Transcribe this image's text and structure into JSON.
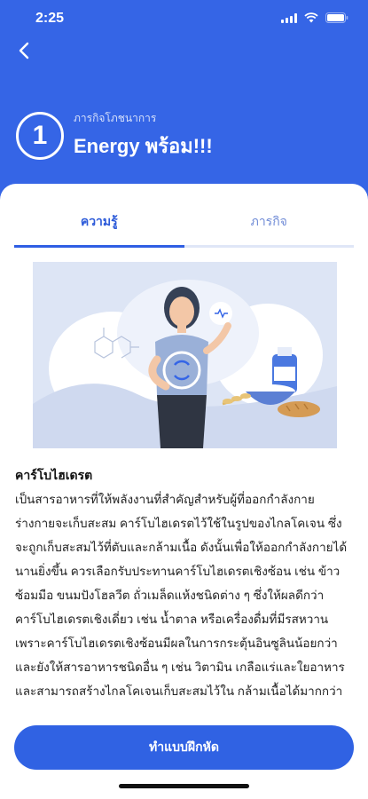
{
  "status_bar": {
    "time": "2:25"
  },
  "header": {
    "mission_number": "1",
    "subtitle": "ภารกิจโภชนาการ",
    "title": "Energy พร้อม!!!"
  },
  "tabs": [
    {
      "label": "ความรู้",
      "active": true
    },
    {
      "label": "ภารกิจ",
      "active": false
    }
  ],
  "article": {
    "title": "คาร์โบไฮเดรต",
    "body": "เป็นสารอาหารที่ให้พลังงานที่สำคัญสำหรับผู้ที่ออกกำลังกาย ร่างกายจะเก็บสะสม คาร์โบไฮเดรตไว้ใช้ในรูปของไกลโคเจน ซึ่งจะถูกเก็บสะสมไว้ที่ตับและกล้ามเนื้อ ดังนั้นเพื่อให้ออกกำลังกายได้นานยิ่งขึ้น ควรเลือกรับประทานคาร์โบไฮเดรตเชิงซ้อน เช่น ข้าวซ้อมมือ ขนมปังโฮลวีต ถั่วเมล็ดแห้งชนิดต่าง ๆ ซึ่งให้ผลดีกว่าคาร์โบไฮเดรตเชิงเดี่ยว เช่น น้ำตาล หรือเครื่องดื่มที่มีรสหวาน เพราะคาร์โบไฮเดรตเชิงซ้อนมีผลในการกระตุ้นอินซูลินน้อยกว่า และยังให้สารอาหารชนิดอื่น ๆ เช่น วิตามิน เกลือแร่และใยอาหาร และสามารถสร้างไกลโคเจนเก็บสะสมไว้ใน กล้ามเนื้อได้มากกว่า"
  },
  "practice_button": {
    "label": "ทำแบบฝึกหัด"
  },
  "colors": {
    "primary": "#3565e6",
    "button": "#3062e3",
    "tab_active": "#2d5bd9"
  }
}
